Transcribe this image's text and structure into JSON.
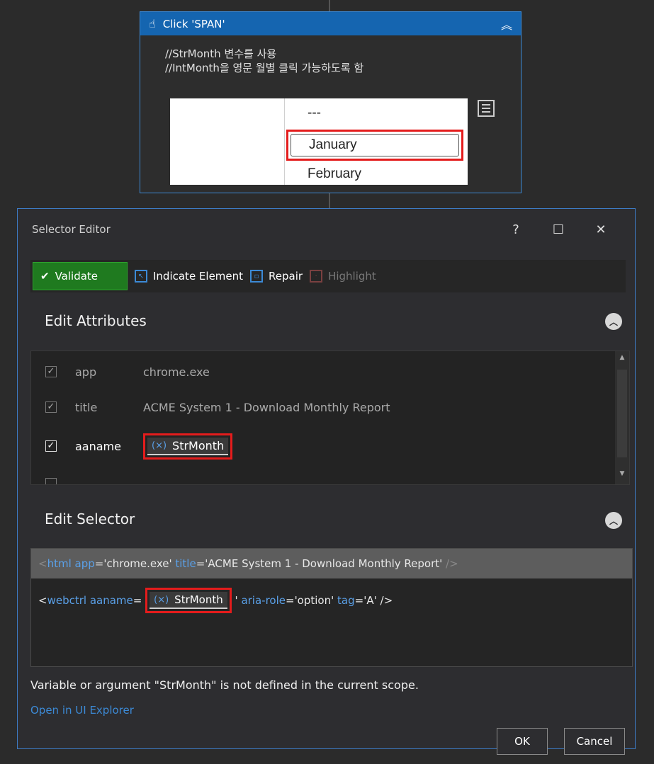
{
  "activity": {
    "title": "Click 'SPAN'",
    "comment_lines": [
      "//StrMonth 변수를 사용",
      "//IntMonth을 영문 월별 클릭 가능하도록 함"
    ],
    "preview": {
      "options": [
        "---",
        "January",
        "February"
      ],
      "selected": "January"
    }
  },
  "dialog": {
    "title": "Selector Editor",
    "help": "?",
    "toolbar": {
      "validate": "Validate",
      "indicate": "Indicate Element",
      "repair": "Repair",
      "highlight": "Highlight"
    },
    "edit_attributes": {
      "title": "Edit Attributes",
      "rows": [
        {
          "name": "app",
          "value": "chrome.exe",
          "checked": true
        },
        {
          "name": "title",
          "value": "ACME System 1 - Download Monthly Report",
          "checked": true
        },
        {
          "name": "aaname",
          "value": "StrMonth",
          "checked": true,
          "is_variable": true
        }
      ]
    },
    "edit_selector": {
      "title": "Edit Selector",
      "line1": {
        "tag": "html",
        "attr1": "app",
        "val1": "'chrome.exe'",
        "attr2": "title",
        "val2": "'ACME System 1 - Download Monthly Report'"
      },
      "line2": {
        "tag": "webctrl",
        "attr1": "aaname",
        "var": "StrMonth",
        "attr2": "aria-role",
        "val2": "'option'",
        "attr3": "tag",
        "val3": "'A'"
      }
    },
    "error": "Variable or argument \"StrMonth\" is not defined in the current scope.",
    "open_link": "Open in UI Explorer",
    "ok": "OK",
    "cancel": "Cancel"
  }
}
